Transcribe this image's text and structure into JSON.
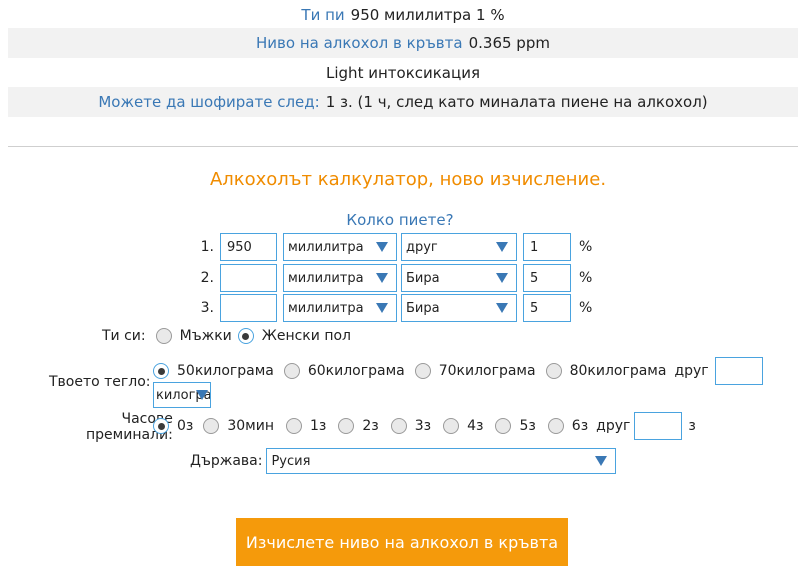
{
  "results": {
    "you_drank_label": "Ти пи",
    "you_drank_value": "950 милилитра 1 %",
    "bac_label": "Ниво на алкохол в кръвта",
    "bac_value": "0.365 ppm",
    "intoxication": "Light интоксикация",
    "drive_label": "Можете да шофирате след:",
    "drive_value": "1 з. (1 ч, след като миналата пиене на алкохол)"
  },
  "form": {
    "heading": "Алкохолът калкулатор, ново изчисление.",
    "drinks_title": "Колко пиете?",
    "percent_sign": "%",
    "drinks": [
      {
        "num": "1.",
        "amount": "950",
        "unit": "милилитра",
        "type": "друг",
        "percent": "1"
      },
      {
        "num": "2.",
        "amount": "",
        "unit": "милилитра",
        "type": "Бира",
        "percent": "5"
      },
      {
        "num": "3.",
        "amount": "",
        "unit": "милилитра",
        "type": "Бира",
        "percent": "5"
      }
    ],
    "gender_label": "Ти си:",
    "gender_options": [
      "Мъжки",
      "Женски пол"
    ],
    "gender_selected": "Женски пол",
    "weight_label": "Твоето тегло:",
    "weight_options": [
      "50килограма",
      "60килограма",
      "70килограма",
      "80килограма"
    ],
    "weight_selected": "50килограма",
    "weight_other_label": "друг",
    "weight_other_value": "",
    "weight_unit": "килогра",
    "hours_label_line1": "Часове",
    "hours_label_line2": "преминали:",
    "hours_options": [
      "0з",
      "30мин",
      "1з",
      "2з",
      "3з",
      "4з",
      "5з",
      "6з"
    ],
    "hours_selected": "0з",
    "hours_other_label": "друг",
    "hours_other_value": "",
    "hours_unit": "з",
    "country_label": "Държава:",
    "country_value": "Русия",
    "submit_label": "Изчислете ниво на алкохол в кръвта"
  },
  "colors": {
    "accent_orange": "#f59a0b",
    "link_blue": "#3a78b5",
    "input_border": "#4aa3df"
  }
}
